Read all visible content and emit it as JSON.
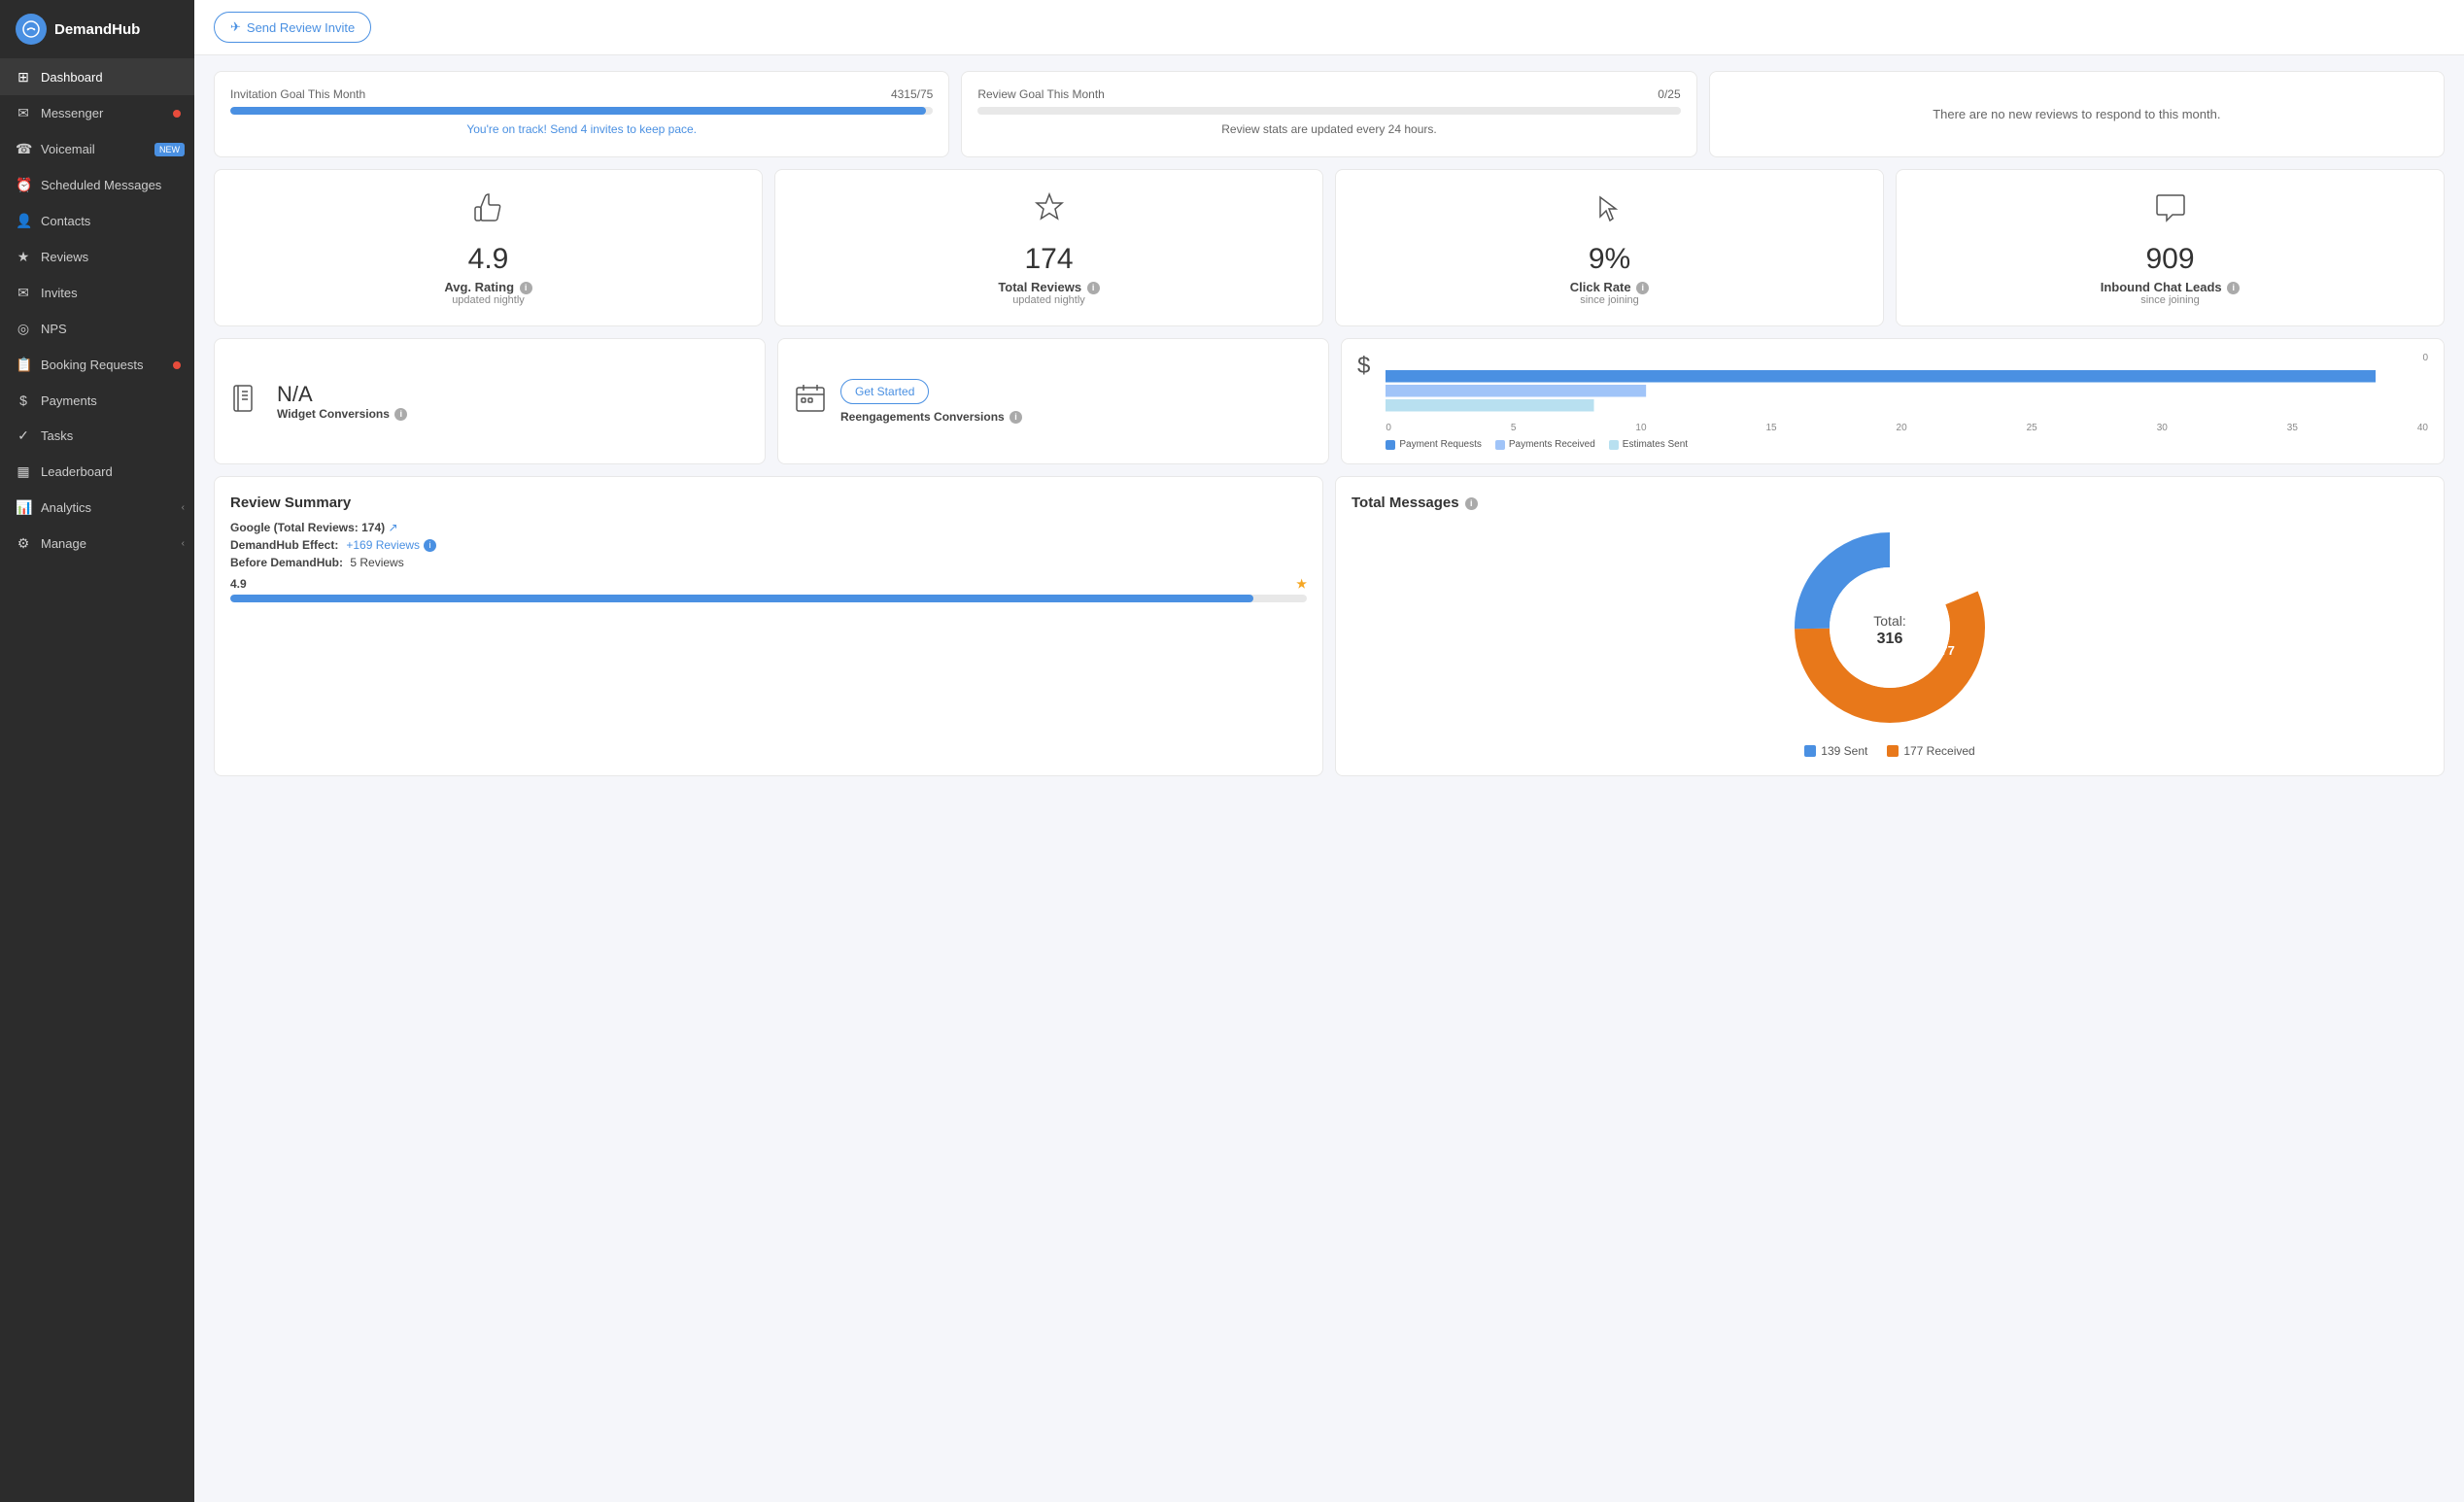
{
  "app": {
    "name": "DemandHub"
  },
  "sidebar": {
    "items": [
      {
        "id": "dashboard",
        "label": "Dashboard",
        "icon": "⊞",
        "active": true,
        "badge": null
      },
      {
        "id": "messenger",
        "label": "Messenger",
        "icon": "✉",
        "active": false,
        "badge": "dot"
      },
      {
        "id": "voicemail",
        "label": "Voicemail",
        "icon": "☎",
        "active": false,
        "badge": "new"
      },
      {
        "id": "scheduled",
        "label": "Scheduled Messages",
        "icon": "⏰",
        "active": false,
        "badge": null
      },
      {
        "id": "contacts",
        "label": "Contacts",
        "icon": "👤",
        "active": false,
        "badge": null
      },
      {
        "id": "reviews",
        "label": "Reviews",
        "icon": "★",
        "active": false,
        "badge": null
      },
      {
        "id": "invites",
        "label": "Invites",
        "icon": "✉",
        "active": false,
        "badge": null
      },
      {
        "id": "nps",
        "label": "NPS",
        "icon": "◎",
        "active": false,
        "badge": null
      },
      {
        "id": "booking",
        "label": "Booking Requests",
        "icon": "📋",
        "active": false,
        "badge": "dot"
      },
      {
        "id": "payments",
        "label": "Payments",
        "icon": "$",
        "active": false,
        "badge": null
      },
      {
        "id": "tasks",
        "label": "Tasks",
        "icon": "✓",
        "active": false,
        "badge": null
      },
      {
        "id": "leaderboard",
        "label": "Leaderboard",
        "icon": "▦",
        "active": false,
        "badge": null
      },
      {
        "id": "analytics",
        "label": "Analytics",
        "icon": "📊",
        "active": false,
        "badge": null,
        "chevron": true
      },
      {
        "id": "manage",
        "label": "Manage",
        "icon": "⚙",
        "active": false,
        "badge": null,
        "chevron": true
      }
    ]
  },
  "topbar": {
    "send_review_button": "Send Review Invite"
  },
  "goal_cards": [
    {
      "label": "Invitation Goal This Month",
      "value": "4315/75",
      "progress": 99,
      "hint": "You're on track! Send 4 invites to keep pace.",
      "type": "progress"
    },
    {
      "label": "Review Goal This Month",
      "value": "0/25",
      "progress": 0,
      "hint": "Review stats are updated every 24 hours.",
      "type": "subtitle"
    },
    {
      "label": "",
      "value": "",
      "hint": "There are no new reviews to respond to this month.",
      "type": "noreviews"
    }
  ],
  "stats": [
    {
      "icon": "👍",
      "value": "4.9",
      "label": "Avg. Rating",
      "sub": "updated nightly"
    },
    {
      "icon": "★",
      "value": "174",
      "label": "Total Reviews",
      "sub": "updated nightly"
    },
    {
      "icon": "↗",
      "value": "9%",
      "label": "Click Rate",
      "sub": "since joining"
    },
    {
      "icon": "💬",
      "value": "909",
      "label": "Inbound Chat Leads",
      "sub": "since joining"
    }
  ],
  "widgets": [
    {
      "icon": "📖",
      "value": "N/A",
      "label": "Widget Conversions"
    },
    {
      "icon": "📅",
      "label": "Reengagements Conversions",
      "button": "Get Started"
    }
  ],
  "payments_chart": {
    "title": "Payments",
    "y_labels": [
      "0",
      ""
    ],
    "x_labels": [
      "0",
      "5",
      "10",
      "15",
      "20",
      "25",
      "30",
      "35",
      "40"
    ],
    "bars": [
      {
        "label": "Payment Requests",
        "color": "#4a90e2",
        "width": 38
      },
      {
        "label": "Payments Received",
        "color": "#a0c4f8",
        "width": 10
      },
      {
        "label": "Estimates Sent",
        "color": "#b8e0f0",
        "width": 8
      }
    ],
    "legend": [
      {
        "label": "Payment Requests",
        "color": "#4a90e2"
      },
      {
        "label": "Payments Received",
        "color": "#a0c4f8"
      },
      {
        "label": "Estimates Sent",
        "color": "#b8e0f0"
      }
    ]
  },
  "review_summary": {
    "title": "Review Summary",
    "google_label": "Google (Total Reviews: 174)",
    "effect_label": "DemandHub Effect:",
    "effect_value": "+169 Reviews",
    "before_label": "Before DemandHub:",
    "before_value": "5 Reviews",
    "rating": "4.9",
    "progress": 95
  },
  "total_messages": {
    "title": "Total Messages",
    "total": "Total: 316",
    "sent": 139,
    "received": 177,
    "sent_label": "139 Sent",
    "received_label": "177 Received",
    "sent_color": "#4a90e2",
    "received_color": "#e8781a"
  }
}
